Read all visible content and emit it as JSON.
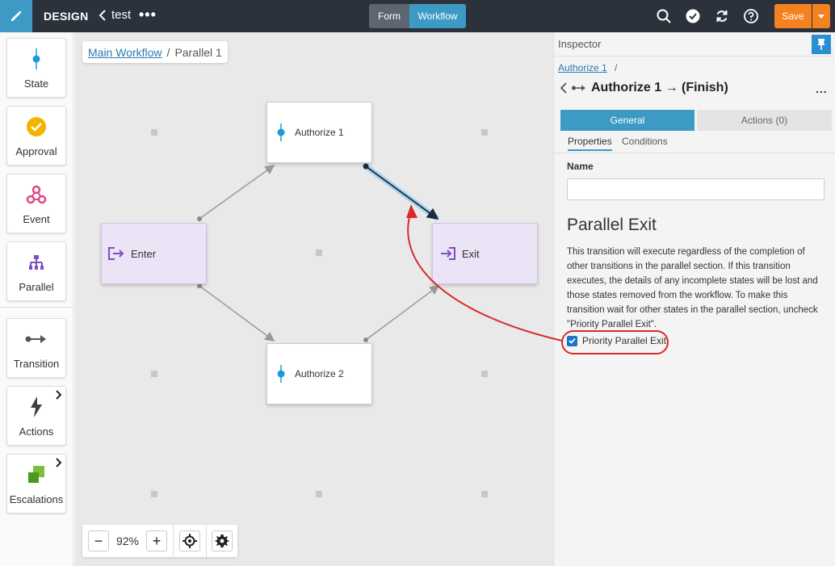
{
  "topbar": {
    "title": "DESIGN",
    "back_label": "test",
    "more": "•••",
    "mode_form": "Form",
    "mode_workflow": "Workflow",
    "save_label": "Save",
    "icons": [
      "edit-icon",
      "search-icon",
      "validate-icon",
      "refresh-icon",
      "help-icon",
      "caret-down-icon"
    ]
  },
  "palette": {
    "items": [
      {
        "label": "State",
        "icon": "state-icon"
      },
      {
        "label": "Approval",
        "icon": "approval-icon"
      },
      {
        "label": "Event",
        "icon": "event-icon"
      },
      {
        "label": "Parallel",
        "icon": "parallel-icon"
      },
      {
        "label": "Transition",
        "icon": "transition-icon"
      },
      {
        "label": "Actions",
        "icon": "lightning-icon"
      },
      {
        "label": "Escalations",
        "icon": "escalations-icon"
      }
    ]
  },
  "canvas": {
    "breadcrumb": {
      "link": "Main Workflow",
      "separator": "/",
      "current": "Parallel 1"
    },
    "nodes": {
      "authorize1": "Authorize 1",
      "authorize2": "Authorize 2",
      "enter": "Enter",
      "exit": "Exit"
    },
    "zoom": {
      "value": "92%",
      "minus": "−",
      "plus": "+"
    }
  },
  "inspector": {
    "title": "Inspector",
    "crumb_link": "Authorize 1",
    "crumb_sep": "/",
    "heading": "Authorize 1 → (Finish)",
    "more": "...",
    "tab_general": "General",
    "tab_actions": "Actions (0)",
    "subtab_properties": "Properties",
    "subtab_conditions": "Conditions",
    "name_label": "Name",
    "name_value": "",
    "section_title": "Parallel Exit",
    "description": "This transition will execute regardless of the completion of other transitions in the parallel section. If this transition executes, the details of any incomplete states will be lost and those states removed from the workflow. To make this transition wait for other states in the parallel section, uncheck \"Priority Parallel Exit\".",
    "priority_label": "Priority Parallel Exit",
    "priority_checked": true
  },
  "colors": {
    "topbar": "#2b323b",
    "accent": "#3d9ac4",
    "save": "#f58220",
    "annotation": "#d72b2b",
    "parallel_node": "#ebe3f6"
  }
}
